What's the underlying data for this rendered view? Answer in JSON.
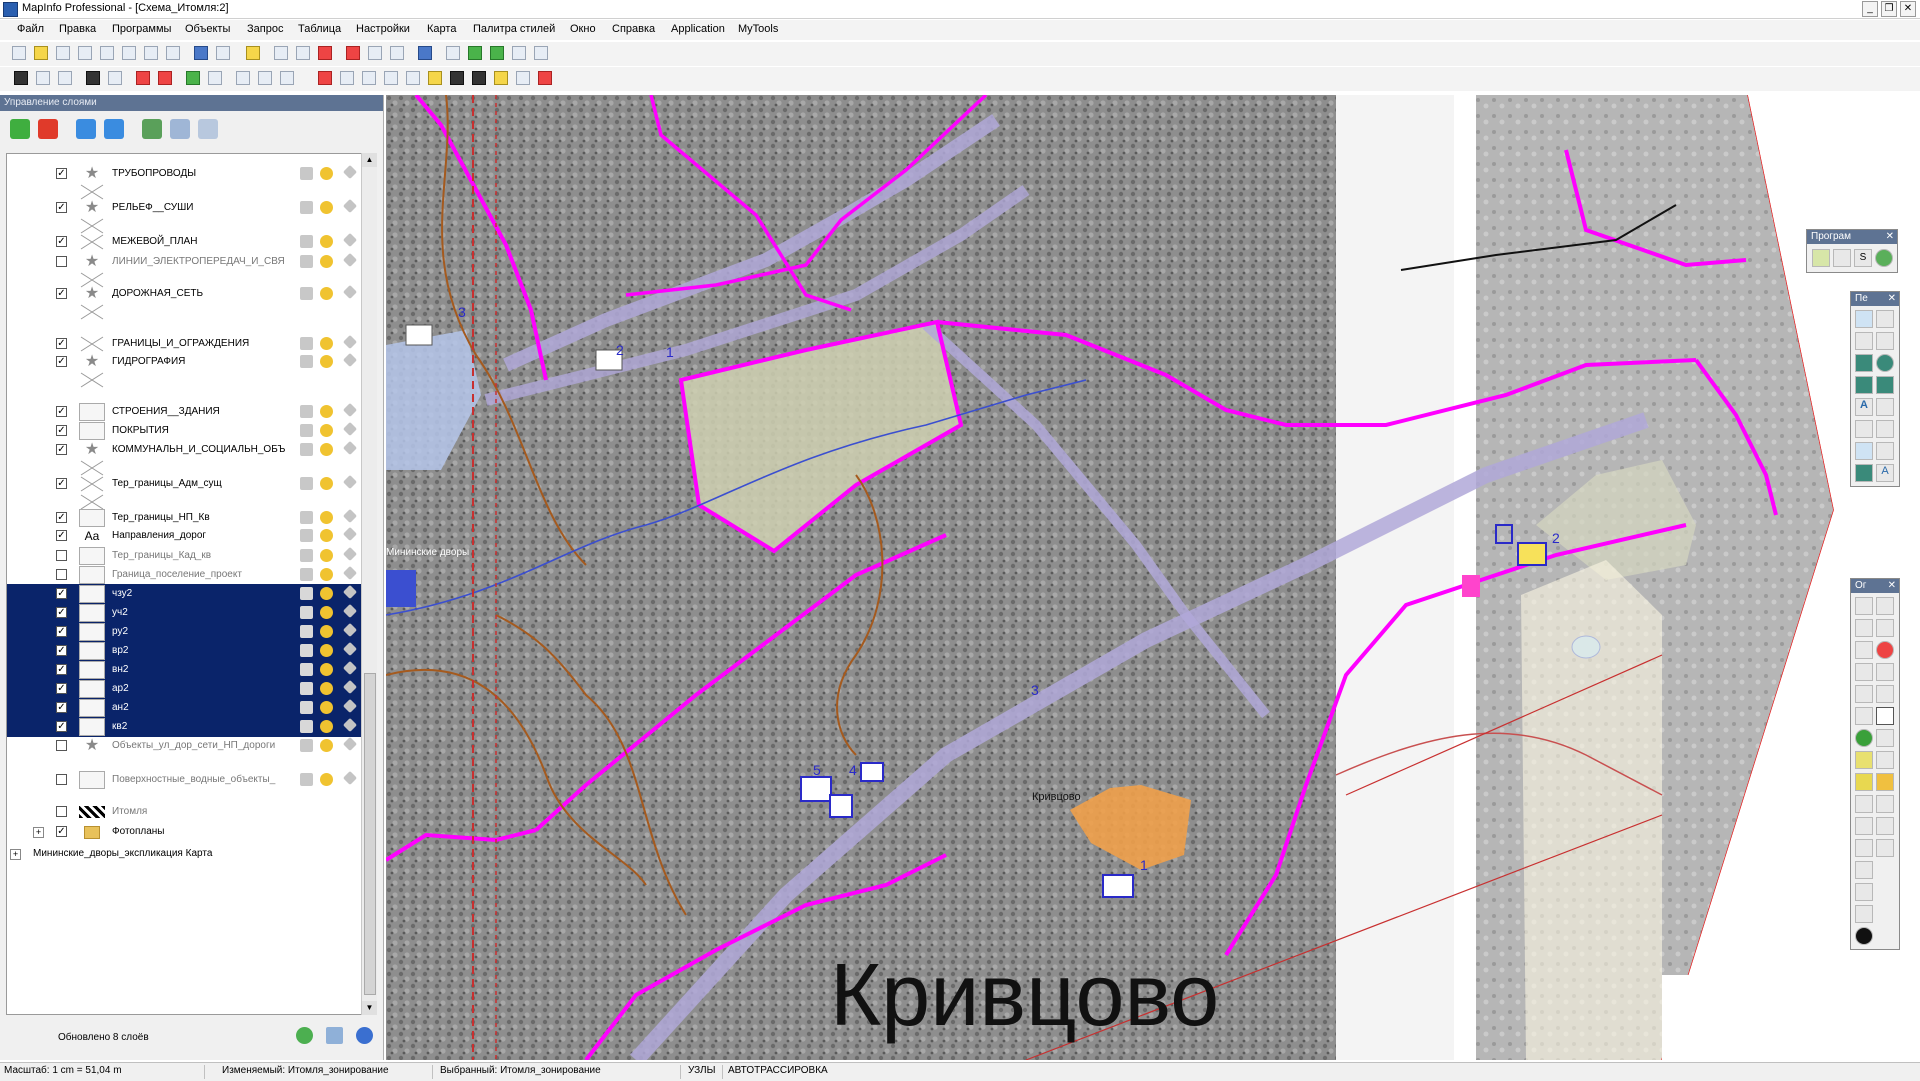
{
  "window": {
    "title": "MapInfo Professional - [Схема_Итомля:2]"
  },
  "menu": {
    "items": [
      "Файл",
      "Правка",
      "Программы",
      "Объекты",
      "Запрос",
      "Таблица",
      "Настройки",
      "Карта",
      "Палитра стилей",
      "Окно",
      "Справка",
      "Application",
      "MyTools"
    ]
  },
  "layer_panel": {
    "title": "Управление слоями",
    "status": "Обновлено 8 слоёв",
    "layers": [
      {
        "name": "ТРУБОПРОВОДЫ",
        "checked": true,
        "symbol": "star",
        "selected": false
      },
      {
        "name": "РЕЛЬЕФ__СУШИ",
        "checked": true,
        "symbol": "star",
        "selected": false
      },
      {
        "name": "МЕЖЕВОЙ_ПЛАН",
        "checked": true,
        "symbol": "cross",
        "selected": false
      },
      {
        "name": "ЛИНИИ_ЭЛЕКТРОПЕРЕДАЧ_И_СВЯ",
        "checked": false,
        "symbol": "star",
        "selected": false
      },
      {
        "name": "ДОРОЖНАЯ_СЕТЬ",
        "checked": true,
        "symbol": "star",
        "selected": false
      },
      {
        "name": "ГРАНИЦЫ_И_ОГРАЖДЕНИЯ",
        "checked": true,
        "symbol": "cross",
        "selected": false
      },
      {
        "name": "ГИДРОГРАФИЯ",
        "checked": true,
        "symbol": "star",
        "selected": false
      },
      {
        "name": "СТРОЕНИЯ__ЗДАНИЯ",
        "checked": true,
        "symbol": "box",
        "selected": false
      },
      {
        "name": "ПОКРЫТИЯ",
        "checked": true,
        "symbol": "box",
        "selected": false
      },
      {
        "name": "КОММУНАЛЬН_И_СОЦИАЛЬН_ОБЪ",
        "checked": true,
        "symbol": "star",
        "selected": false
      },
      {
        "name": "Тер_границы_Адм_сущ",
        "checked": true,
        "symbol": "cross",
        "selected": false
      },
      {
        "name": "Тер_границы_НП_Кв",
        "checked": true,
        "symbol": "box",
        "selected": false
      },
      {
        "name": "Направления_дорог",
        "checked": true,
        "symbol": "text",
        "selected": false
      },
      {
        "name": "Тер_границы_Кад_кв",
        "checked": false,
        "symbol": "box",
        "selected": false
      },
      {
        "name": "Граница_поселение_проект",
        "checked": false,
        "symbol": "box",
        "selected": false
      },
      {
        "name": "чзу2",
        "checked": true,
        "symbol": "box",
        "selected": true
      },
      {
        "name": "уч2",
        "checked": true,
        "symbol": "box",
        "selected": true
      },
      {
        "name": "ру2",
        "checked": true,
        "symbol": "box",
        "selected": true
      },
      {
        "name": "вр2",
        "checked": true,
        "symbol": "box",
        "selected": true
      },
      {
        "name": "вн2",
        "checked": true,
        "symbol": "box",
        "selected": true
      },
      {
        "name": "ар2",
        "checked": true,
        "symbol": "box",
        "selected": true
      },
      {
        "name": "ан2",
        "checked": true,
        "symbol": "box",
        "selected": true
      },
      {
        "name": "кв2",
        "checked": true,
        "symbol": "box",
        "selected": true
      },
      {
        "name": "Объекты_ул_дор_сети_НП_дороги",
        "checked": false,
        "symbol": "star",
        "selected": false
      },
      {
        "name": "Поверхностные_водные_объекты_",
        "checked": false,
        "symbol": "box",
        "selected": false
      },
      {
        "name": "Итомля",
        "checked": false,
        "symbol": "checker",
        "selected": false
      },
      {
        "name": "Фотопланы",
        "checked": true,
        "symbol": "folder",
        "selected": false
      }
    ],
    "text_symbol": "Aa",
    "footer_map": "Мининские_дворы_экспликация Карта"
  },
  "map": {
    "big_label": "Кривцово",
    "small_label": "Кривцово",
    "road_label": "Мининские дворы",
    "markers": [
      "1",
      "2",
      "3",
      "4",
      "5",
      "3",
      "2",
      "1"
    ]
  },
  "palettes": {
    "programs_title": "Програм",
    "drawing_title": "Пе",
    "main_title": "Ог",
    "programs_s": "S"
  },
  "statusbar": {
    "scale": "Масштаб: 1 cm = 51,04 m",
    "editable": "Изменяемый: Итомля_зонирование",
    "selected": "Выбранный: Итомля_зонирование",
    "nodes": "УЗЛЫ",
    "autotrace": "АВТОТРАССИРОВКА"
  },
  "colors": {
    "selection": "#0a246a",
    "boundary": "#ff00ff",
    "road": "#b0a8d8",
    "panel_title": "#5e7393"
  }
}
